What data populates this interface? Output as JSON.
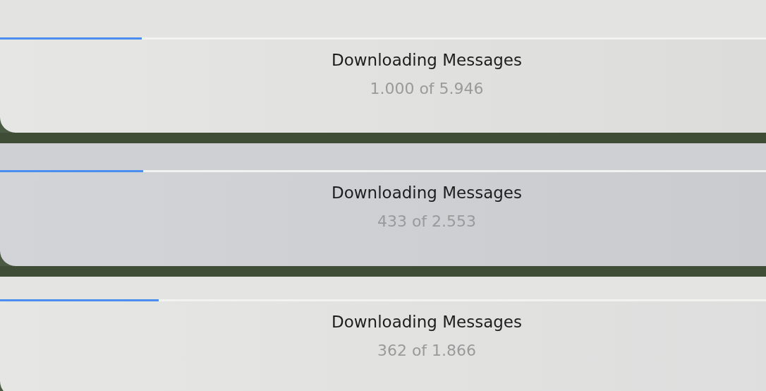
{
  "panels": [
    {
      "title": "Downloading Messages",
      "count": "1.000 of 5.946",
      "level": 0.185
    },
    {
      "title": "Downloading Messages",
      "count": "433 of 2.553",
      "level": 0.187
    },
    {
      "title": "Downloading Messages",
      "count": "362 of 1.866",
      "level": 0.207
    }
  ]
}
